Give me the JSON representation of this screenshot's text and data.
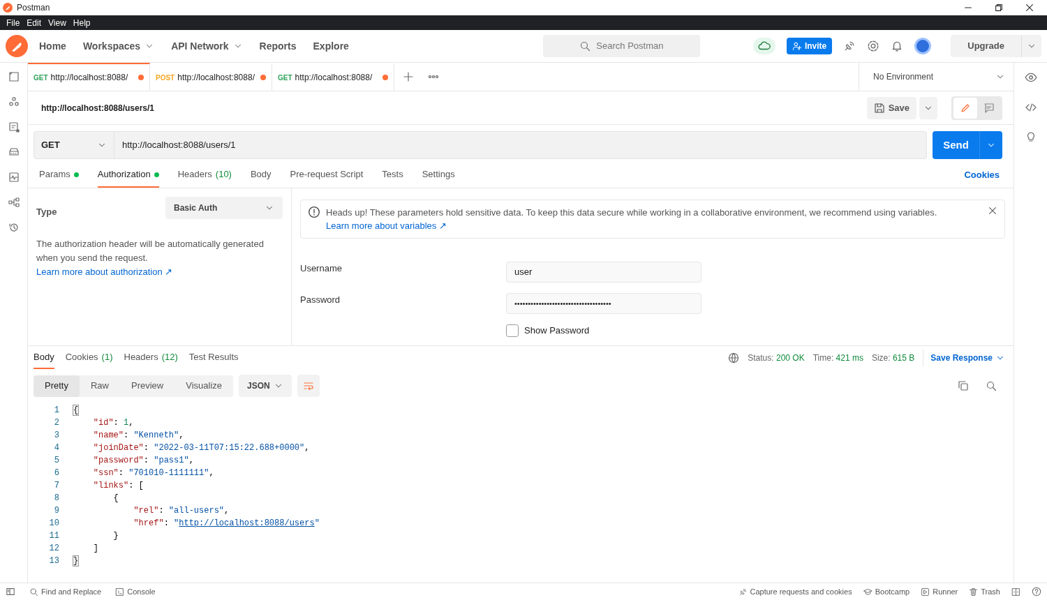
{
  "window": {
    "title": "Postman"
  },
  "menu": [
    {
      "label": "File"
    },
    {
      "label": "Edit"
    },
    {
      "label": "View"
    },
    {
      "label": "Help"
    }
  ],
  "nav": [
    {
      "label": "Home",
      "dropdown": false
    },
    {
      "label": "Workspaces",
      "dropdown": true
    },
    {
      "label": "API Network",
      "dropdown": true
    },
    {
      "label": "Reports",
      "dropdown": false
    },
    {
      "label": "Explore",
      "dropdown": false
    }
  ],
  "search": {
    "placeholder": "Search Postman"
  },
  "invite": "Invite",
  "upgrade": "Upgrade",
  "tabs": [
    {
      "method": "GET",
      "color": "#2fa35a",
      "url": "http://localhost:8088/",
      "selected": true,
      "unsaved": true
    },
    {
      "method": "POST",
      "color": "#f5a623",
      "url": "http://localhost:8088/",
      "selected": false,
      "unsaved": true
    },
    {
      "method": "GET",
      "color": "#2fa35a",
      "url": "http://localhost:8088/",
      "selected": false,
      "unsaved": true
    }
  ],
  "environment": "No Environment",
  "request": {
    "title": "http://localhost:8088/users/1",
    "save": "Save",
    "method": "GET",
    "url": "http://localhost:8088/users/1",
    "send": "Send"
  },
  "request_tabs": [
    {
      "label": "Params",
      "dot": true,
      "selected": false
    },
    {
      "label": "Authorization",
      "dot": true,
      "selected": true
    },
    {
      "label": "Headers",
      "count": "(10)",
      "dot": false,
      "selected": false
    },
    {
      "label": "Body",
      "dot": false,
      "selected": false
    },
    {
      "label": "Pre-request Script",
      "dot": false,
      "selected": false
    },
    {
      "label": "Tests",
      "dot": false,
      "selected": false
    },
    {
      "label": "Settings",
      "dot": false,
      "selected": false
    }
  ],
  "cookies": "Cookies",
  "auth": {
    "type_label": "Type",
    "type_value": "Basic Auth",
    "description": "The authorization header will be automatically generated when you send the request.",
    "learn_more": "Learn more about authorization ↗",
    "notice": {
      "text": "Heads up! These parameters hold sensitive data. To keep this data secure while working in a collaborative environment, we recommend using variables.",
      "link": "Learn more about variables ↗"
    },
    "fields": [
      {
        "label": "Username",
        "value": "user",
        "kind": "text"
      },
      {
        "label": "Password",
        "value": "••••••••••••••••••••••••••••••••••••",
        "kind": "password"
      }
    ],
    "show_password": {
      "label": "Show Password",
      "checked": false
    }
  },
  "response": {
    "tabs": [
      {
        "label": "Body",
        "selected": true
      },
      {
        "label": "Cookies",
        "count": "(1)",
        "selected": false
      },
      {
        "label": "Headers",
        "count": "(12)",
        "selected": false
      },
      {
        "label": "Test Results",
        "selected": false
      }
    ],
    "status": [
      {
        "label": "Status:",
        "value": "200 OK"
      },
      {
        "label": "Time:",
        "value": "421 ms"
      },
      {
        "label": "Size:",
        "value": "615 B"
      }
    ],
    "save_response": "Save Response",
    "views": [
      {
        "label": "Pretty",
        "selected": true
      },
      {
        "label": "Raw",
        "selected": false
      },
      {
        "label": "Preview",
        "selected": false
      },
      {
        "label": "Visualize",
        "selected": false
      }
    ],
    "format": "JSON",
    "lines": [
      {
        "n": "1",
        "tokens": [
          {
            "text": "{",
            "kind": "bracket"
          }
        ]
      },
      {
        "n": "2",
        "tokens": [
          {
            "text": "    \"id\"",
            "kind": "key"
          },
          {
            "text": ": ",
            "kind": "punct"
          },
          {
            "text": "1",
            "kind": "number"
          },
          {
            "text": ",",
            "kind": "punct"
          }
        ]
      },
      {
        "n": "3",
        "tokens": [
          {
            "text": "    \"name\"",
            "kind": "key"
          },
          {
            "text": ": ",
            "kind": "punct"
          },
          {
            "text": "\"Kenneth\"",
            "kind": "string"
          },
          {
            "text": ",",
            "kind": "punct"
          }
        ]
      },
      {
        "n": "4",
        "tokens": [
          {
            "text": "    \"joinDate\"",
            "kind": "key"
          },
          {
            "text": ": ",
            "kind": "punct"
          },
          {
            "text": "\"2022-03-11T07:15:22.688+0000\"",
            "kind": "string"
          },
          {
            "text": ",",
            "kind": "punct"
          }
        ]
      },
      {
        "n": "5",
        "tokens": [
          {
            "text": "    \"password\"",
            "kind": "key"
          },
          {
            "text": ": ",
            "kind": "punct"
          },
          {
            "text": "\"pass1\"",
            "kind": "string"
          },
          {
            "text": ",",
            "kind": "punct"
          }
        ]
      },
      {
        "n": "6",
        "tokens": [
          {
            "text": "    \"ssn\"",
            "kind": "key"
          },
          {
            "text": ": ",
            "kind": "punct"
          },
          {
            "text": "\"701010-1111111\"",
            "kind": "string"
          },
          {
            "text": ",",
            "kind": "punct"
          }
        ]
      },
      {
        "n": "7",
        "tokens": [
          {
            "text": "    \"links\"",
            "kind": "key"
          },
          {
            "text": ": [",
            "kind": "punct"
          }
        ]
      },
      {
        "n": "8",
        "tokens": [
          {
            "text": "        {",
            "kind": "punct"
          }
        ]
      },
      {
        "n": "9",
        "tokens": [
          {
            "text": "            \"rel\"",
            "kind": "key"
          },
          {
            "text": ": ",
            "kind": "punct"
          },
          {
            "text": "\"all-users\"",
            "kind": "string"
          },
          {
            "text": ",",
            "kind": "punct"
          }
        ]
      },
      {
        "n": "10",
        "tokens": [
          {
            "text": "            \"href\"",
            "kind": "key"
          },
          {
            "text": ": ",
            "kind": "punct"
          },
          {
            "text": "\"",
            "kind": "string"
          },
          {
            "text": "http://localhost:8088/users",
            "kind": "url"
          },
          {
            "text": "\"",
            "kind": "string"
          }
        ]
      },
      {
        "n": "11",
        "tokens": [
          {
            "text": "        }",
            "kind": "punct"
          }
        ]
      },
      {
        "n": "12",
        "tokens": [
          {
            "text": "    ]",
            "kind": "punct"
          }
        ]
      },
      {
        "n": "13",
        "tokens": [
          {
            "text": "}",
            "kind": "bracket"
          }
        ]
      }
    ]
  },
  "footer": {
    "left": [
      {
        "label": "Find and Replace"
      },
      {
        "label": "Console"
      }
    ],
    "right": [
      {
        "label": "Capture requests and cookies"
      },
      {
        "label": "Bootcamp"
      },
      {
        "label": "Runner"
      },
      {
        "label": "Trash"
      }
    ]
  }
}
